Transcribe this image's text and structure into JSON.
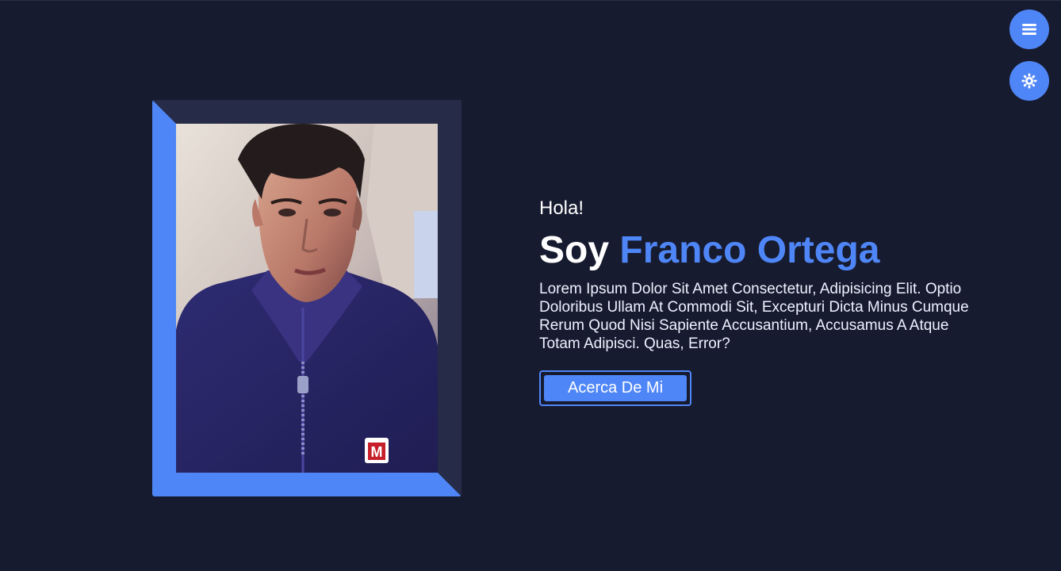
{
  "header": {
    "menu_icon": "hamburger-menu-icon",
    "theme_icon": "sun-gear-icon"
  },
  "hero": {
    "greeting": "Hola!",
    "headline_prefix": "Soy",
    "name": "Franco Ortega",
    "bio": "Lorem Ipsum Dolor Sit Amet Consectetur, Adipisicing Elit. Optio Doloribus Ullam At Commodi Sit, Excepturi Dicta Minus Cumque Rerum Quod Nisi Sapiente Accusantium, Accusamus A Atque Totam Adipisci. Quas, Error?",
    "button_label": "Acerca De Mi",
    "photo_badge": "M"
  },
  "colors": {
    "background": "#171b2f",
    "accent": "#4f86f7",
    "frame_panel": "#262b48",
    "text": "#ffffff"
  }
}
